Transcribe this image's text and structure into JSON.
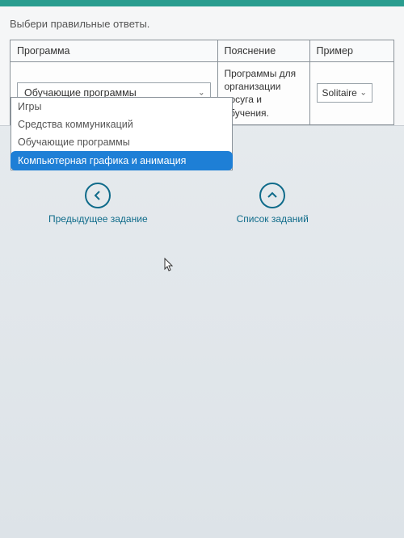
{
  "instruction": "Выбери правильные ответы.",
  "table": {
    "headers": {
      "program": "Программа",
      "explain": "Пояснение",
      "example": "Пример"
    },
    "row": {
      "program_selected": "Обучающие программы",
      "explanation": "Программы для организации досуга и обучения.",
      "example_selected": "Solitaire"
    }
  },
  "dropdown": {
    "options": [
      "Игры",
      "Средства коммуникаций",
      "Обучающие программы",
      "Компьютерная графика и анимация"
    ],
    "highlighted_index": 3
  },
  "nav": {
    "prev": "Предыдущее задание",
    "list": "Список заданий"
  }
}
